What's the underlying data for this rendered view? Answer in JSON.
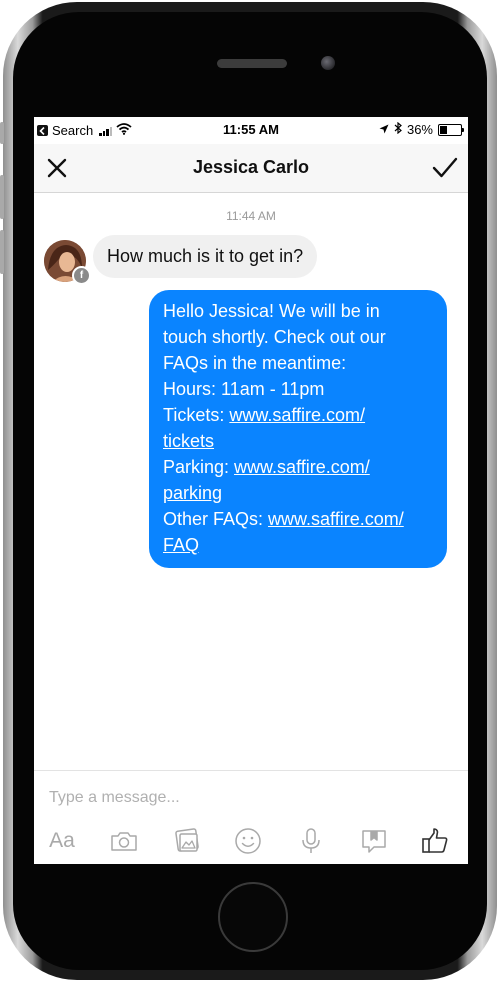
{
  "status_bar": {
    "back_app": "Search",
    "time": "11:55 AM",
    "battery": "36%"
  },
  "nav": {
    "title": "Jessica Carlo",
    "close_icon": "close-icon",
    "confirm_icon": "checkmark-icon"
  },
  "conversation": {
    "timestamp": "11:44 AM",
    "incoming": {
      "text": "How much is it to get in?",
      "badge": "f"
    },
    "outgoing": {
      "lines": [
        {
          "text": "Hello Jessica! We will be in"
        },
        {
          "text": "touch shortly. Check out our"
        },
        {
          "text": "FAQs in the meantime:"
        },
        {
          "text": "Hours: 11am - 11pm"
        }
      ],
      "tickets_label": "Tickets: ",
      "tickets_link_1": "www.saffire.com/",
      "tickets_link_2": "tickets",
      "parking_label": "Parking: ",
      "parking_link_1": "www.saffire.com/",
      "parking_link_2": "parking",
      "faqs_label": "Other FAQs: ",
      "faqs_link_1": "www.saffire.com/",
      "faqs_link_2": "FAQ"
    }
  },
  "composer": {
    "placeholder": "Type a message...",
    "aa_label": "Aa",
    "tools": [
      "text-format-icon",
      "camera-icon",
      "gallery-icon",
      "emoji-icon",
      "microphone-icon",
      "saved-reply-icon",
      "thumbs-up-icon"
    ]
  },
  "colors": {
    "outgoing_bubble": "#0a84ff",
    "incoming_bubble": "#f0f0f0",
    "toolbar_icon": "#a9a9a9"
  }
}
